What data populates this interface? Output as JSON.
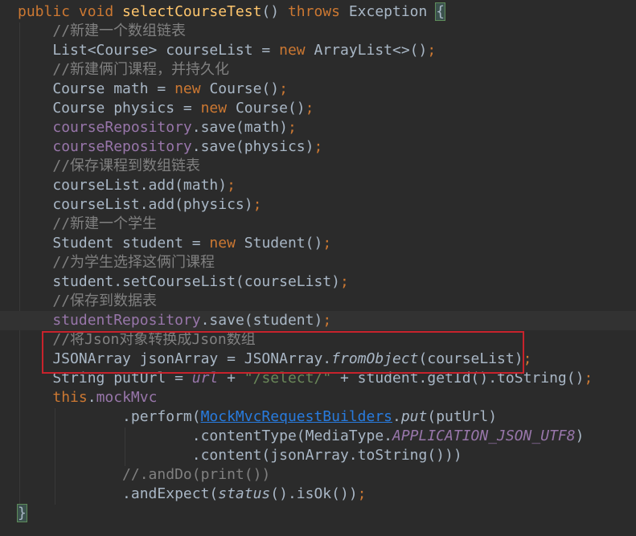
{
  "editor": {
    "language": "Java",
    "theme_colors": {
      "background": "#2b2b2b",
      "keyword": "#cc7832",
      "method": "#ffc66d",
      "comment": "#808080",
      "field": "#9876aa",
      "string": "#6a8759",
      "link": "#287bde",
      "highlight_box": "#c8232c"
    },
    "lines": [
      [
        {
          "c": "kw",
          "t": "public void "
        },
        {
          "c": "fn",
          "t": "selectCourseTest"
        },
        {
          "c": "def",
          "t": "() "
        },
        {
          "c": "kw",
          "t": "throws "
        },
        {
          "c": "def",
          "t": "Exception "
        },
        {
          "c": "brace",
          "t": "{"
        }
      ],
      [
        {
          "c": "def",
          "t": "    "
        },
        {
          "c": "comment",
          "t": "//新建一个数组链表"
        }
      ],
      [
        {
          "c": "def",
          "t": "    List<Course> courseList = "
        },
        {
          "c": "kw",
          "t": "new "
        },
        {
          "c": "def",
          "t": "ArrayList<>()"
        },
        {
          "c": "kw",
          "t": ";"
        }
      ],
      [
        {
          "c": "def",
          "t": "    "
        },
        {
          "c": "comment",
          "t": "//新建俩门课程，并持久化"
        }
      ],
      [
        {
          "c": "def",
          "t": "    Course math = "
        },
        {
          "c": "kw",
          "t": "new "
        },
        {
          "c": "def",
          "t": "Course()"
        },
        {
          "c": "kw",
          "t": ";"
        }
      ],
      [
        {
          "c": "def",
          "t": "    Course physics = "
        },
        {
          "c": "kw",
          "t": "new "
        },
        {
          "c": "def",
          "t": "Course()"
        },
        {
          "c": "kw",
          "t": ";"
        }
      ],
      [
        {
          "c": "def",
          "t": "    "
        },
        {
          "c": "field",
          "t": "courseRepository"
        },
        {
          "c": "def",
          "t": ".save(math)"
        },
        {
          "c": "kw",
          "t": ";"
        }
      ],
      [
        {
          "c": "def",
          "t": "    "
        },
        {
          "c": "field",
          "t": "courseRepository"
        },
        {
          "c": "def",
          "t": ".save(physics)"
        },
        {
          "c": "kw",
          "t": ";"
        }
      ],
      [
        {
          "c": "def",
          "t": "    "
        },
        {
          "c": "comment",
          "t": "//保存课程到数组链表"
        }
      ],
      [
        {
          "c": "def",
          "t": "    courseList.add(math)"
        },
        {
          "c": "kw",
          "t": ";"
        }
      ],
      [
        {
          "c": "def",
          "t": "    courseList.add(physics)"
        },
        {
          "c": "kw",
          "t": ";"
        }
      ],
      [
        {
          "c": "def",
          "t": "    "
        },
        {
          "c": "comment",
          "t": "//新建一个学生"
        }
      ],
      [
        {
          "c": "def",
          "t": "    Student student = "
        },
        {
          "c": "kw",
          "t": "new "
        },
        {
          "c": "def",
          "t": "Student()"
        },
        {
          "c": "kw",
          "t": ";"
        }
      ],
      [
        {
          "c": "def",
          "t": "    "
        },
        {
          "c": "comment",
          "t": "//为学生选择这俩门课程"
        }
      ],
      [
        {
          "c": "def",
          "t": "    student.setCourseList(courseList)"
        },
        {
          "c": "kw",
          "t": ";"
        }
      ],
      [
        {
          "c": "def",
          "t": "    "
        },
        {
          "c": "comment",
          "t": "//保存到数据表"
        }
      ],
      [
        {
          "c": "def",
          "t": "    "
        },
        {
          "c": "field",
          "t": "studentRepository"
        },
        {
          "c": "def",
          "t": ".save(student)"
        },
        {
          "c": "kw",
          "t": ";"
        }
      ],
      [
        {
          "c": "def",
          "t": "    "
        },
        {
          "c": "comment",
          "t": "//将Json对象转换成Json数组"
        }
      ],
      [
        {
          "c": "def",
          "t": "    JSONArray jsonArray = JSONArray."
        },
        {
          "c": "ital",
          "t": "fromObject"
        },
        {
          "c": "def",
          "t": "(courseList)"
        },
        {
          "c": "kw",
          "t": ";"
        }
      ],
      [
        {
          "c": "def",
          "t": "    String putUrl = "
        },
        {
          "c": "static",
          "t": "url"
        },
        {
          "c": "def",
          "t": " + "
        },
        {
          "c": "str",
          "t": "\"/select/\""
        },
        {
          "c": "def",
          "t": " + student.getId().toString()"
        },
        {
          "c": "kw",
          "t": ";"
        }
      ],
      [
        {
          "c": "def",
          "t": "    "
        },
        {
          "c": "kw",
          "t": "this"
        },
        {
          "c": "def",
          "t": "."
        },
        {
          "c": "field",
          "t": "mockMvc"
        }
      ],
      [
        {
          "c": "def",
          "t": "            .perform("
        },
        {
          "c": "link",
          "t": "MockMvcRequestBuilders"
        },
        {
          "c": "def",
          "t": "."
        },
        {
          "c": "ital",
          "t": "put"
        },
        {
          "c": "def",
          "t": "(putUrl)"
        }
      ],
      [
        {
          "c": "def",
          "t": "                    .contentType(MediaType."
        },
        {
          "c": "static",
          "t": "APPLICATION_JSON_UTF8"
        },
        {
          "c": "def",
          "t": ")"
        }
      ],
      [
        {
          "c": "def",
          "t": "                    .content(jsonArray.toString()))"
        }
      ],
      [
        {
          "c": "def",
          "t": "            "
        },
        {
          "c": "comment",
          "t": "//.andDo(print())"
        }
      ],
      [
        {
          "c": "def",
          "t": "            .andExpect("
        },
        {
          "c": "ital",
          "t": "status"
        },
        {
          "c": "def",
          "t": "().isOk())"
        },
        {
          "c": "kw",
          "t": ";"
        }
      ],
      [
        {
          "c": "brace",
          "t": "}"
        }
      ]
    ]
  }
}
